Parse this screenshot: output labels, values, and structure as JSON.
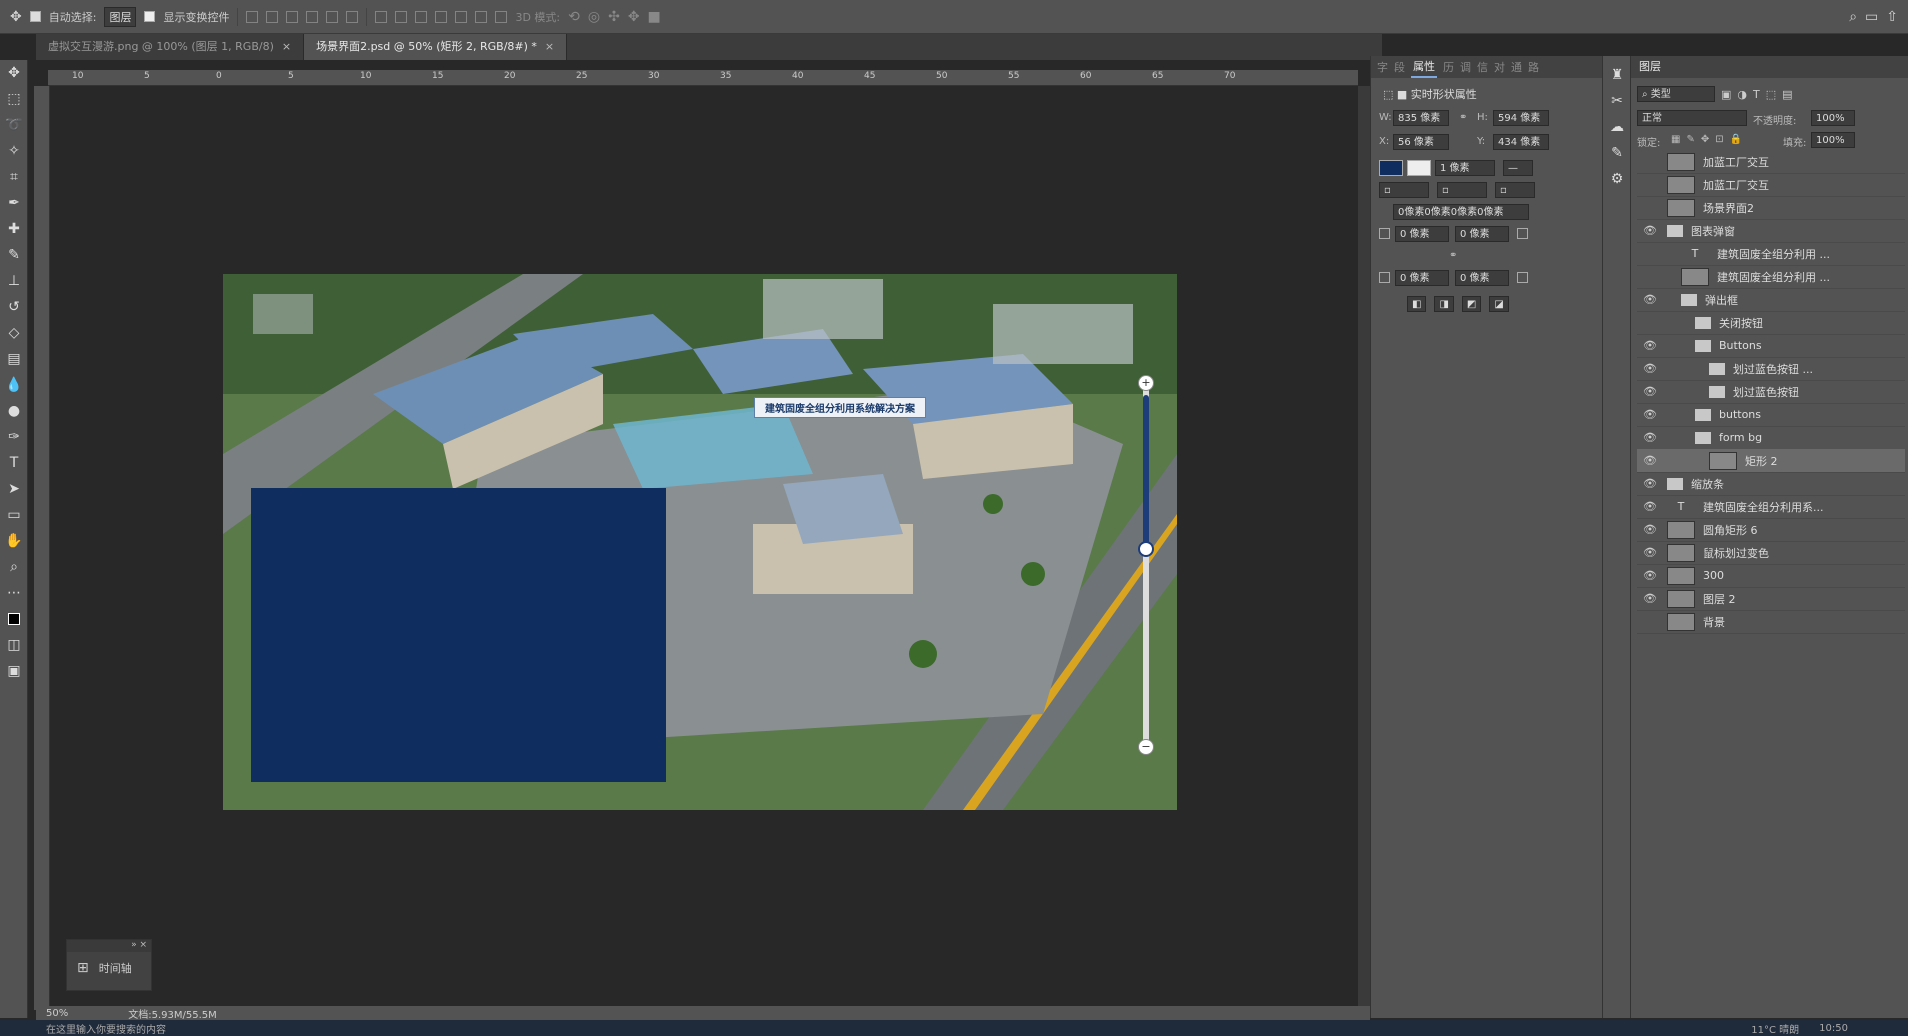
{
  "options_bar": {
    "auto_select_label": "自动选择:",
    "auto_select_value": "图层",
    "show_transform_label": "显示变换控件",
    "mode_3d_label": "3D 模式:"
  },
  "tabs": [
    {
      "label": "虚拟交互漫游.png @ 100% (图层 1, RGB/8)",
      "close": "×"
    },
    {
      "label": "场景界面2.psd @ 50% (矩形 2, RGB/8#) *",
      "close": "×"
    }
  ],
  "ruler_ticks": [
    "10",
    "5",
    "0",
    "5",
    "10",
    "15",
    "20",
    "25",
    "30",
    "35",
    "40",
    "45",
    "50",
    "55",
    "60",
    "65",
    "70"
  ],
  "canvas": {
    "overlay_label": "建筑固废全组分利用系统解决方案",
    "colors": {
      "rect": "#0f2d5e",
      "canvas_bg": "#282828"
    }
  },
  "timeline": {
    "label": "时间轴"
  },
  "status": {
    "zoom": "50%",
    "doc": "文档:5.93M/55.5M"
  },
  "properties": {
    "tabs": [
      "字",
      "段",
      "属性",
      "历",
      "调",
      "信",
      "对",
      "通",
      "路"
    ],
    "active_tab": "属性",
    "title": "实时形状属性",
    "w_label": "W:",
    "w_value": "835 像素",
    "h_label": "H:",
    "h_value": "594 像素",
    "x_label": "X:",
    "x_value": "56 像素",
    "y_label": "Y:",
    "y_value": "434 像素",
    "stroke_width": "1 像素",
    "radius_all": "0像素0像素0像素0像素",
    "r_tl": "0 像素",
    "r_tr": "0 像素",
    "r_bl": "0 像素",
    "r_br": "0 像素"
  },
  "layers_panel": {
    "title": "图层",
    "filter": "类型",
    "blend": "正常",
    "opacity_label": "不透明度:",
    "opacity": "100%",
    "lock_label": "锁定:",
    "fill_label": "填充:",
    "fill": "100%",
    "layers": [
      {
        "name": "加蓝工厂交互",
        "indent": 0,
        "kind": "img",
        "eye": false
      },
      {
        "name": "加蓝工厂交互",
        "indent": 0,
        "kind": "img",
        "eye": false
      },
      {
        "name": "场景界面2",
        "indent": 0,
        "kind": "img",
        "eye": false
      },
      {
        "name": "图表弹窗",
        "indent": 0,
        "kind": "folder",
        "eye": true
      },
      {
        "name": "建筑固废全组分利用 ...",
        "indent": 1,
        "kind": "text",
        "eye": false
      },
      {
        "name": "建筑固废全组分利用 ...",
        "indent": 1,
        "kind": "img",
        "eye": false
      },
      {
        "name": "弹出框",
        "indent": 1,
        "kind": "folder",
        "eye": true
      },
      {
        "name": "关闭按钮",
        "indent": 2,
        "kind": "folder",
        "eye": false
      },
      {
        "name": "Buttons",
        "indent": 2,
        "kind": "folder",
        "eye": true
      },
      {
        "name": "划过蓝色按钮 ...",
        "indent": 3,
        "kind": "folder",
        "eye": true
      },
      {
        "name": "划过蓝色按钮",
        "indent": 3,
        "kind": "folder",
        "eye": true
      },
      {
        "name": "buttons",
        "indent": 2,
        "kind": "folder",
        "eye": true
      },
      {
        "name": "form bg",
        "indent": 2,
        "kind": "folder",
        "eye": true
      },
      {
        "name": "矩形 2",
        "indent": 3,
        "kind": "img",
        "eye": true,
        "selected": true
      },
      {
        "name": "缩放条",
        "indent": 0,
        "kind": "folder",
        "eye": true
      },
      {
        "name": "建筑固废全组分利用系...",
        "indent": 0,
        "kind": "text",
        "eye": true
      },
      {
        "name": "圆角矩形 6",
        "indent": 0,
        "kind": "img",
        "eye": true
      },
      {
        "name": "鼠标划过变色",
        "indent": 0,
        "kind": "img",
        "eye": true
      },
      {
        "name": "300",
        "indent": 0,
        "kind": "img",
        "eye": true
      },
      {
        "name": "图层 2",
        "indent": 0,
        "kind": "img",
        "eye": true
      },
      {
        "name": "背景",
        "indent": 0,
        "kind": "img",
        "eye": false
      }
    ]
  },
  "taskbar": {
    "search": "在这里输入你要搜索的内容",
    "time": "10:50",
    "weather": "11°C 晴朗"
  }
}
